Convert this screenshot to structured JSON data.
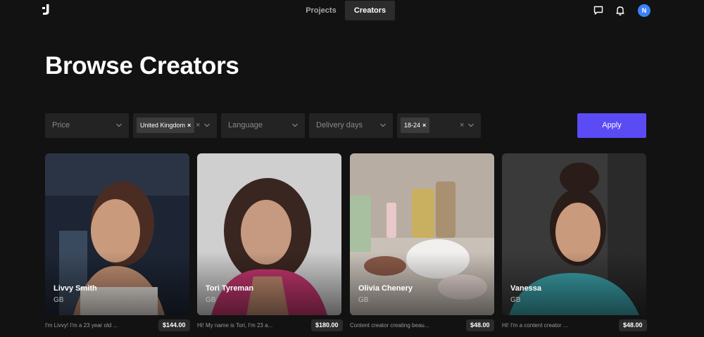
{
  "nav": {
    "tabs": [
      {
        "label": "Projects",
        "active": false
      },
      {
        "label": "Creators",
        "active": true
      }
    ],
    "avatar_initial": "N",
    "icons": [
      "logo-icon",
      "chat-icon",
      "bell-icon"
    ]
  },
  "page": {
    "title": "Browse Creators"
  },
  "filters": {
    "price_placeholder": "Price",
    "country_chip": "United Kingdom",
    "language_placeholder": "Language",
    "delivery_placeholder": "Delivery days",
    "age_chip": "18-24",
    "chip_remove": "×",
    "clear": "×",
    "apply_label": "Apply"
  },
  "creators": [
    {
      "name": "Livvy Smith",
      "country": "GB",
      "bio": "I'm Livvy! I'm a 23 year old ...",
      "price": "$144.00"
    },
    {
      "name": "Tori Tyreman",
      "country": "GB",
      "bio": "Hi! My name is Tori, I'm 23 a...",
      "price": "$180.00"
    },
    {
      "name": "Olivia Chenery",
      "country": "GB",
      "bio": "Content creator creating beau...",
      "price": "$48.00"
    },
    {
      "name": "Vanessa",
      "country": "GB",
      "bio": "Hi! I'm a content creator ...",
      "price": "$48.00"
    }
  ],
  "colors": {
    "background": "#121212",
    "accent": "#5b4bf5",
    "avatar": "#3b82f6"
  }
}
